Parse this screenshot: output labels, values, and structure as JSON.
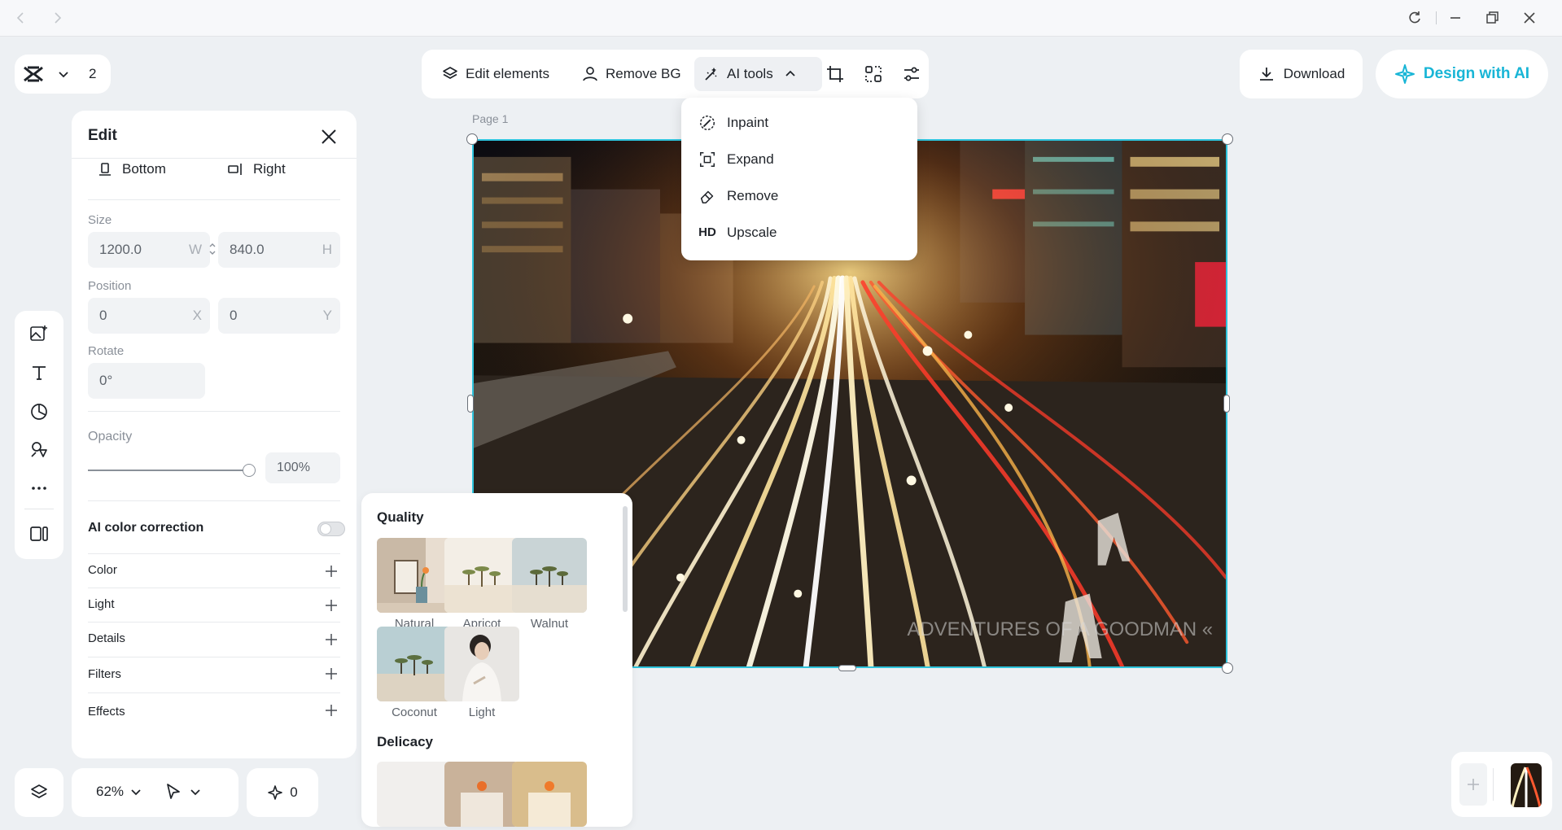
{
  "window": {
    "back_icon": "chevron-left-icon",
    "forward_icon": "chevron-right-icon",
    "refresh_icon": "refresh-icon",
    "minimize_icon": "minimize-icon",
    "restore_icon": "restore-icon",
    "close_icon": "close-icon"
  },
  "brand": {
    "logo": "capcut-logo",
    "count": "2"
  },
  "toolbar": {
    "edit_elements": "Edit elements",
    "remove_bg": "Remove BG",
    "ai_tools": "AI tools",
    "icons": [
      "crop-icon",
      "smart-select-icon",
      "adjust-sliders-icon"
    ]
  },
  "actions": {
    "download": "Download",
    "design_ai": "Design with AI"
  },
  "ai_menu": {
    "items": [
      {
        "label": "Inpaint",
        "icon": "inpaint-icon"
      },
      {
        "label": "Expand",
        "icon": "expand-icon"
      },
      {
        "label": "Remove",
        "icon": "eraser-icon"
      },
      {
        "label": "Upscale",
        "icon": "HD"
      }
    ]
  },
  "edit_panel": {
    "title": "Edit",
    "align_bottom": "Bottom",
    "align_right": "Right",
    "size_label": "Size",
    "width": "1200.0",
    "width_suffix": "W",
    "height": "840.0",
    "height_suffix": "H",
    "position_label": "Position",
    "pos_x": "0",
    "pos_x_suffix": "X",
    "pos_y": "0",
    "pos_y_suffix": "Y",
    "rotate_label": "Rotate",
    "rotate": "0°",
    "opacity_label": "Opacity",
    "opacity": "100%",
    "opacity_value": 1.0,
    "ai_color_correction": "AI color correction",
    "ai_color_correction_on": false,
    "sections": [
      "Color",
      "Light",
      "Details",
      "Filters",
      "Effects"
    ]
  },
  "filters_popup": {
    "quality_title": "Quality",
    "quality": [
      "Natural",
      "Apricot",
      "Walnut",
      "Coconut",
      "Light"
    ],
    "delicacy_title": "Delicacy"
  },
  "canvas": {
    "page_label": "Page 1",
    "watermark": "ADVENTURES OF A GOODMAN «"
  },
  "bottom": {
    "zoom": "62%",
    "ai_count": "0"
  },
  "colors": {
    "accent": "#18b5d6",
    "selection": "#2ec4dd"
  }
}
